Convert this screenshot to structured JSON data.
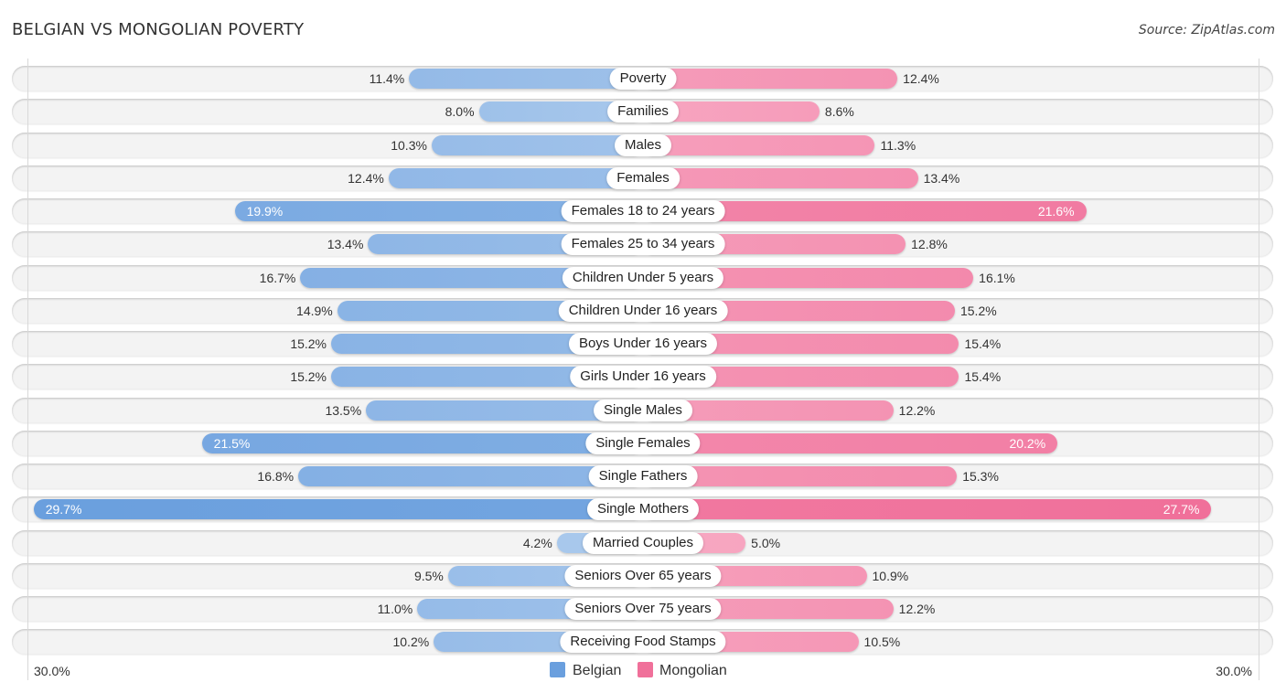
{
  "header": {
    "title": "BELGIAN VS MONGOLIAN POVERTY",
    "source": "Source: ZipAtlas.com"
  },
  "colors": {
    "belgian_light": "#a9c8ec",
    "belgian_strong": "#6a9fde",
    "mongolian_light": "#f7a8c2",
    "mongolian_strong": "#f0709a"
  },
  "chart_data": {
    "type": "bar",
    "orientation": "horizontal-diverging",
    "title": "BELGIAN VS MONGOLIAN POVERTY",
    "xlabel": "",
    "ylabel": "",
    "x_range": [
      -30.0,
      30.0
    ],
    "axis_min_label": "30.0%",
    "axis_max_label": "30.0%",
    "legend_position": "bottom-center",
    "grid": false,
    "categories": [
      "Poverty",
      "Families",
      "Males",
      "Females",
      "Females 18 to 24 years",
      "Females 25 to 34 years",
      "Children Under 5 years",
      "Children Under 16 years",
      "Boys Under 16 years",
      "Girls Under 16 years",
      "Single Males",
      "Single Females",
      "Single Fathers",
      "Single Mothers",
      "Married Couples",
      "Seniors Over 65 years",
      "Seniors Over 75 years",
      "Receiving Food Stamps"
    ],
    "series": [
      {
        "name": "Belgian",
        "side": "left",
        "values": [
          11.4,
          8.0,
          10.3,
          12.4,
          19.9,
          13.4,
          16.7,
          14.9,
          15.2,
          15.2,
          13.5,
          21.5,
          16.8,
          29.7,
          4.2,
          9.5,
          11.0,
          10.2
        ],
        "labels": [
          "11.4%",
          "8.0%",
          "10.3%",
          "12.4%",
          "19.9%",
          "13.4%",
          "16.7%",
          "14.9%",
          "15.2%",
          "15.2%",
          "13.5%",
          "21.5%",
          "16.8%",
          "29.7%",
          "4.2%",
          "9.5%",
          "11.0%",
          "10.2%"
        ]
      },
      {
        "name": "Mongolian",
        "side": "right",
        "values": [
          12.4,
          8.6,
          11.3,
          13.4,
          21.6,
          12.8,
          16.1,
          15.2,
          15.4,
          15.4,
          12.2,
          20.2,
          15.3,
          27.7,
          5.0,
          10.9,
          12.2,
          10.5
        ],
        "labels": [
          "12.4%",
          "8.6%",
          "11.3%",
          "13.4%",
          "21.6%",
          "12.8%",
          "16.1%",
          "15.2%",
          "15.4%",
          "15.4%",
          "12.2%",
          "20.2%",
          "15.3%",
          "27.7%",
          "5.0%",
          "10.9%",
          "12.2%",
          "10.5%"
        ]
      }
    ]
  },
  "legend": {
    "items": [
      {
        "label": "Belgian",
        "color": "#6a9fde"
      },
      {
        "label": "Mongolian",
        "color": "#f0709a"
      }
    ]
  }
}
